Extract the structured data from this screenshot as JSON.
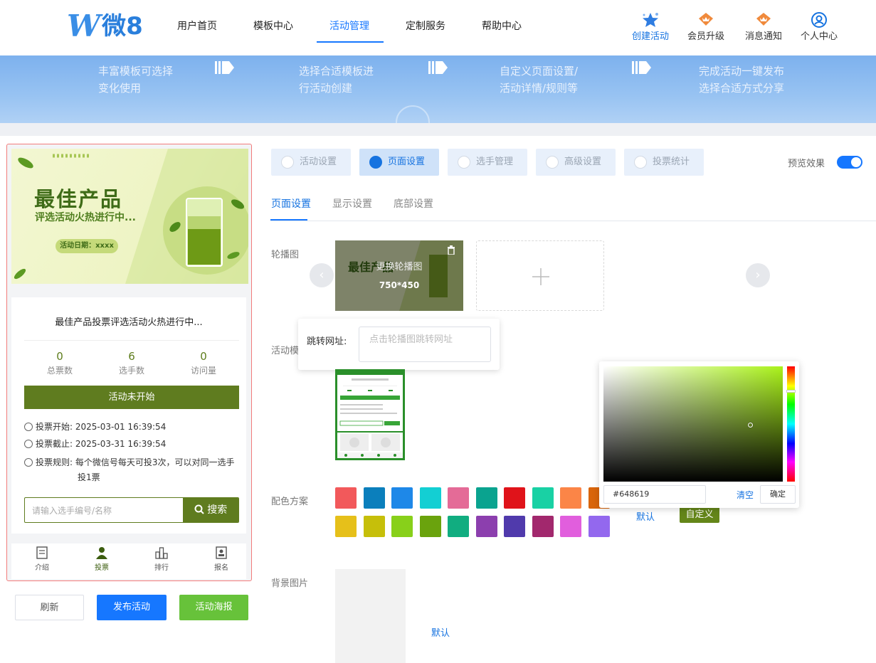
{
  "nav": {
    "logo_text": "微8",
    "items": [
      {
        "label": "用户首页"
      },
      {
        "label": "模板中心"
      },
      {
        "label": "活动管理"
      },
      {
        "label": "定制服务"
      },
      {
        "label": "帮助中心"
      }
    ],
    "actions": [
      {
        "label": "创建活动",
        "icon": "star-icon"
      },
      {
        "label": "会员升级",
        "icon": "crown-icon"
      },
      {
        "label": "消息通知",
        "icon": "crown-bell-icon"
      },
      {
        "label": "个人中心",
        "icon": "user-icon"
      }
    ]
  },
  "banner": {
    "steps": [
      {
        "line1": "丰富模板可选择",
        "line2": "变化使用"
      },
      {
        "line1": "选择合适模板进",
        "line2": "行活动创建"
      },
      {
        "line1": "自定义页面设置/",
        "line2": "活动详情/规则等"
      },
      {
        "line1": "完成活动一键发布",
        "line2": "选择合适方式分享"
      }
    ]
  },
  "preview": {
    "poster_title": "最佳产品",
    "poster_sub": "评选活动火热进行中...",
    "poster_date": "活动日期：xxxx",
    "activity_title": "最佳产品投票评选活动火热进行中...",
    "stats": [
      {
        "value": "0",
        "label": "总票数"
      },
      {
        "value": "6",
        "label": "选手数"
      },
      {
        "value": "0",
        "label": "访问量"
      }
    ],
    "status_button": "活动未开始",
    "start_label": "投票开始:",
    "start_value": "2025-03-01 16:39:54",
    "end_label": "投票截止:",
    "end_value": "2025-03-31 16:39:54",
    "rule_label": "投票规则:",
    "rule_value_1": "每个微信号每天可投3次，可以对同一选手",
    "rule_value_2": "投1票",
    "search_placeholder": "请输入选手编号/名称",
    "search_button": "搜索",
    "tabbar": [
      {
        "label": "介绍"
      },
      {
        "label": "投票"
      },
      {
        "label": "排行"
      },
      {
        "label": "报名"
      }
    ]
  },
  "bottom_buttons": {
    "refresh": "刷新",
    "publish": "发布活动",
    "poster": "活动海报"
  },
  "settings": {
    "tabs": [
      {
        "label": "活动设置"
      },
      {
        "label": "页面设置"
      },
      {
        "label": "选手管理"
      },
      {
        "label": "高级设置"
      },
      {
        "label": "投票统计"
      }
    ],
    "preview_toggle_label": "预览效果",
    "preview_toggle_on": true,
    "subtabs": [
      {
        "label": "页面设置"
      },
      {
        "label": "显示设置"
      },
      {
        "label": "底部设置"
      }
    ],
    "carousel_label": "轮播图",
    "carousel_replace": "更换轮播图",
    "carousel_size": "750*450",
    "jump_url_label": "跳转网址:",
    "jump_url_placeholder": "点击轮播图跳转网址",
    "template_label": "活动模",
    "color_scheme_label": "配色方案",
    "background_label": "背景图片",
    "default_link": "默认",
    "custom_button": "自定义",
    "background_default": "默认"
  },
  "color_picker": {
    "value": "#648619",
    "clear": "清空",
    "confirm": "确定"
  },
  "swatches_row1": [
    "#f2595b",
    "#0b7fbc",
    "#1e88e8",
    "#13cfd3",
    "#e46b97",
    "#0aa38f",
    "#e0131a",
    "#19d1a4",
    "#fb8547",
    "#d9650b"
  ],
  "swatches_row2": [
    "#e6c01a",
    "#c6bf0a",
    "#88d01a",
    "#6aa30d",
    "#11ad80",
    "#8c3fae",
    "#503aac",
    "#a2286d",
    "#e15edd",
    "#9368ee"
  ]
}
